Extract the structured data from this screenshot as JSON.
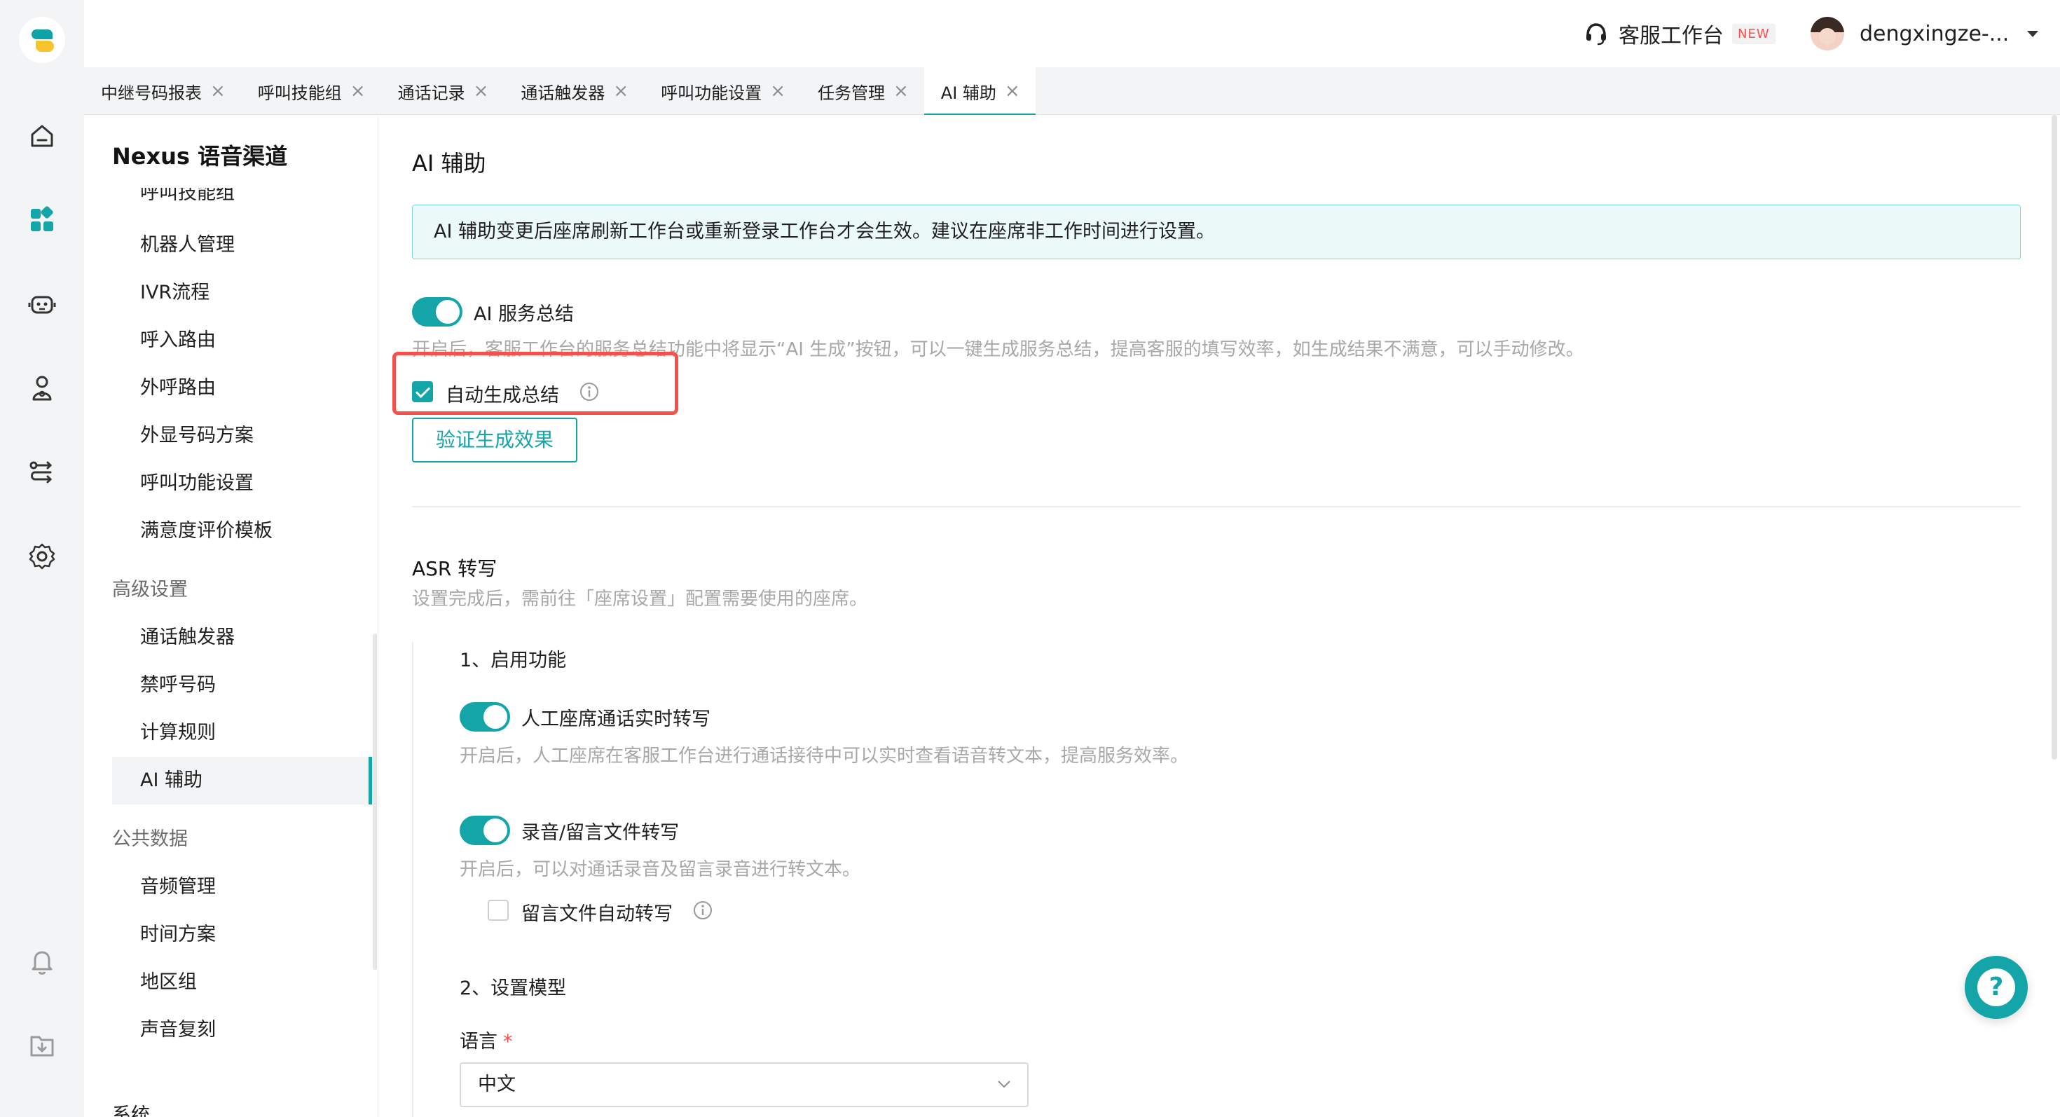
{
  "topbar": {
    "workspace_label": "客服工作台",
    "workspace_badge": "NEW",
    "username": "dengxingze-..."
  },
  "tabs": [
    {
      "label": "中继号码报表",
      "active": false
    },
    {
      "label": "呼叫技能组",
      "active": false
    },
    {
      "label": "通话记录",
      "active": false
    },
    {
      "label": "通话触发器",
      "active": false
    },
    {
      "label": "呼叫功能设置",
      "active": false
    },
    {
      "label": "任务管理",
      "active": false
    },
    {
      "label": "AI 辅助",
      "active": true
    }
  ],
  "sidebar": {
    "title": "Nexus 语音渠道",
    "partial_item": "呼叫技能组",
    "items_top": [
      "机器人管理",
      "IVR流程",
      "呼入路由",
      "外呼路由",
      "外显号码方案",
      "呼叫功能设置",
      "满意度评价模板"
    ],
    "group_advanced": "高级设置",
    "items_advanced": [
      "通话触发器",
      "禁呼号码",
      "计算规则",
      "AI 辅助"
    ],
    "group_public": "公共数据",
    "items_public": [
      "音频管理",
      "时间方案",
      "地区组",
      "声音复刻"
    ],
    "group_system": "系统"
  },
  "main": {
    "title": "AI 辅助",
    "alert": "AI 辅助变更后座席刷新工作台或重新登录工作台才会生效。建议在座席非工作时间进行设置。",
    "summary": {
      "toggle_label": "AI 服务总结",
      "enabled": true,
      "hint": "开启后，客服工作台的服务总结功能中将显示“AI 生成”按钮，可以一键生成服务总结，提高客服的填写效率，如生成结果不满意，可以手动修改。",
      "auto_label": "自动生成总结",
      "auto_checked": true,
      "verify_button": "验证生成效果"
    },
    "asr": {
      "title": "ASR 转写",
      "desc": "设置完成后，需前往「座席设置」配置需要使用的座席。",
      "step1": "1、启用功能",
      "realtime_label": "人工座席通话实时转写",
      "realtime_enabled": true,
      "realtime_hint": "开启后，人工座席在客服工作台进行通话接待中可以实时查看语音转文本，提高服务效率。",
      "file_label": "录音/留言文件转写",
      "file_enabled": true,
      "file_hint": "开启后，可以对通话录音及留言录音进行转文本。",
      "voicemail_label": "留言文件自动转写",
      "voicemail_checked": false,
      "step2": "2、设置模型",
      "language_label": "语言",
      "required_mark": "*",
      "language_value": "中文"
    }
  },
  "help_fab": "?",
  "colors": {
    "accent": "#13a5a8",
    "alert_bg": "#ebfaf9",
    "highlight": "#f5504a",
    "badge_new": "#ff4d4f"
  }
}
